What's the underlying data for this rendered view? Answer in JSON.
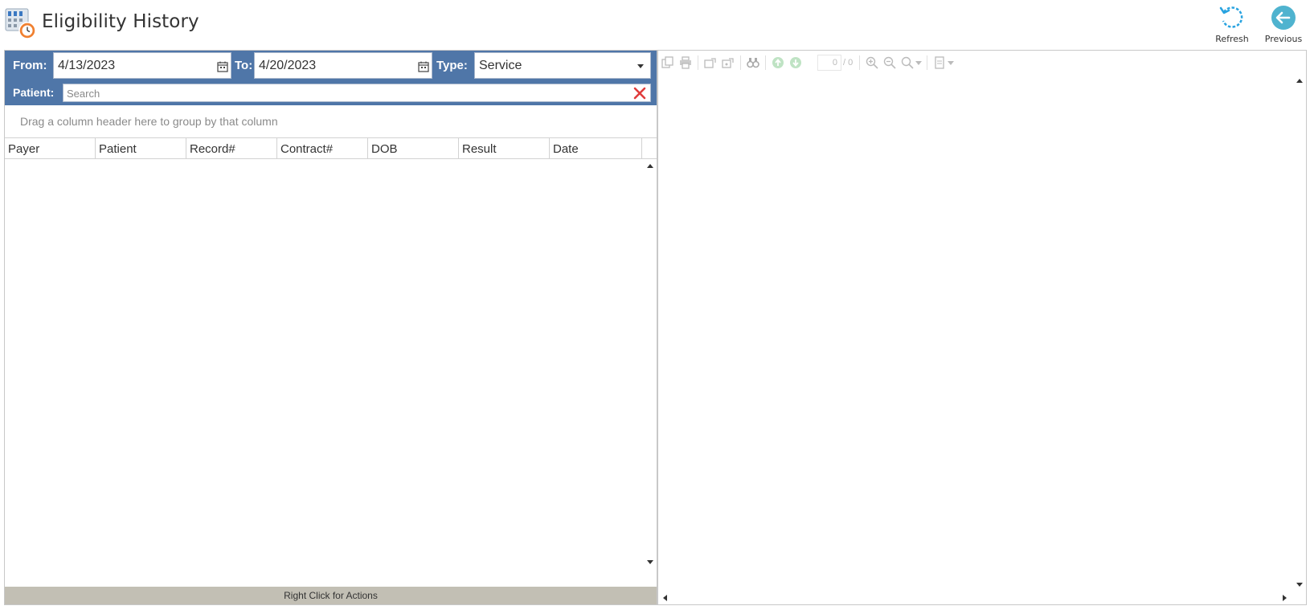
{
  "header": {
    "title": "Eligibility History",
    "refresh_label": "Refresh",
    "previous_label": "Previous"
  },
  "filters": {
    "from_label": "From:",
    "from_value": "4/13/2023",
    "to_label": "To:",
    "to_value": "4/20/2023",
    "type_label": "Type:",
    "type_value": "Service",
    "patient_label": "Patient:",
    "search_placeholder": "Search"
  },
  "grid": {
    "group_hint": "Drag a column header here to group by that column",
    "columns": [
      "Payer",
      "Patient",
      "Record#",
      "Contract#",
      "DOB",
      "Result",
      "Date"
    ],
    "rows": [],
    "status_text": "Right Click for Actions"
  },
  "viewer": {
    "page_current": "0",
    "page_total": "/ 0"
  },
  "colors": {
    "filter_bar": "#4f76a8",
    "status_bar": "#c2bfb4",
    "refresh_icon": "#29a3e0",
    "previous_icon": "#4fb3cf",
    "clear_icon": "#e03c3c"
  },
  "icons": {
    "app": "calendar-clock-icon",
    "refresh": "refresh-icon",
    "previous": "back-arrow-icon",
    "clear": "close-icon"
  }
}
